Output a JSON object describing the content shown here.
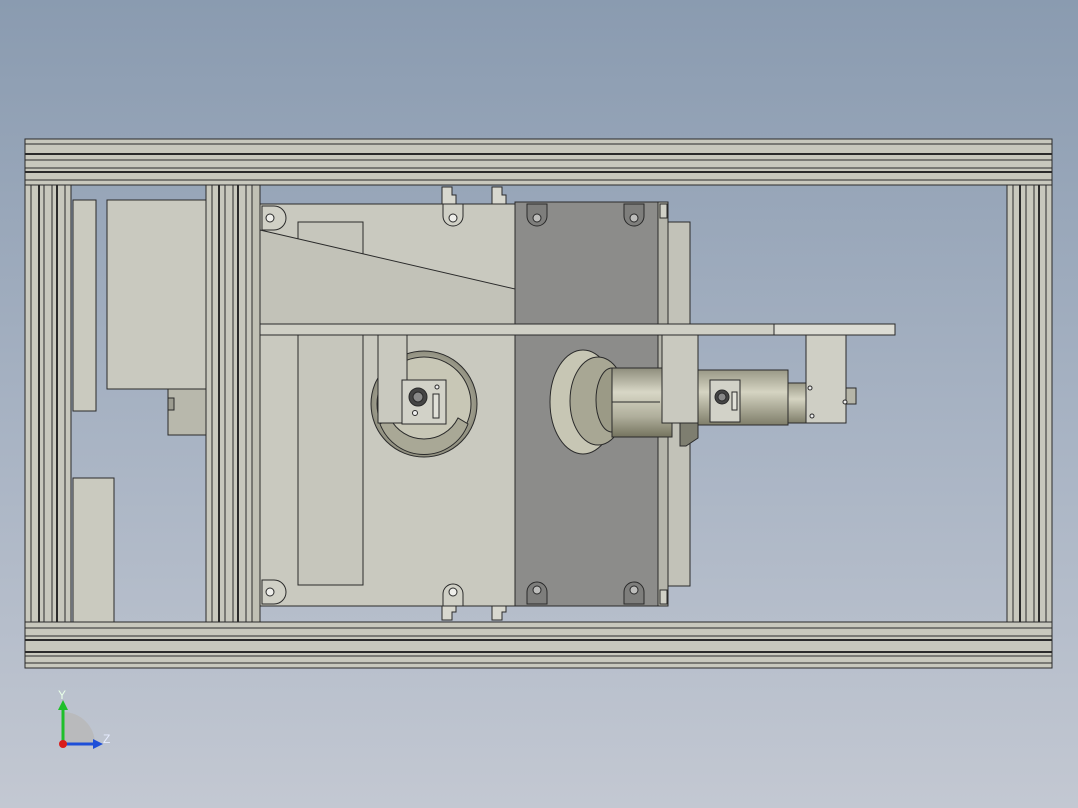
{
  "viewport": {
    "background_top": "#8a9bb0",
    "background_bottom": "#c3c8d2"
  },
  "model": {
    "frame_color": "#c8c8bd",
    "frame_edge_color": "#2a2a2a",
    "plate_color": "#c9c9bf",
    "dark_plate_color": "#8c8c8a",
    "barrel_color": "#b9b8a6"
  },
  "triad": {
    "y_label": "Y",
    "z_label": "Z",
    "y_axis_color": "#1fbf2a",
    "z_axis_color": "#1e4fd8",
    "x_axis_color": "#d91c1c"
  }
}
